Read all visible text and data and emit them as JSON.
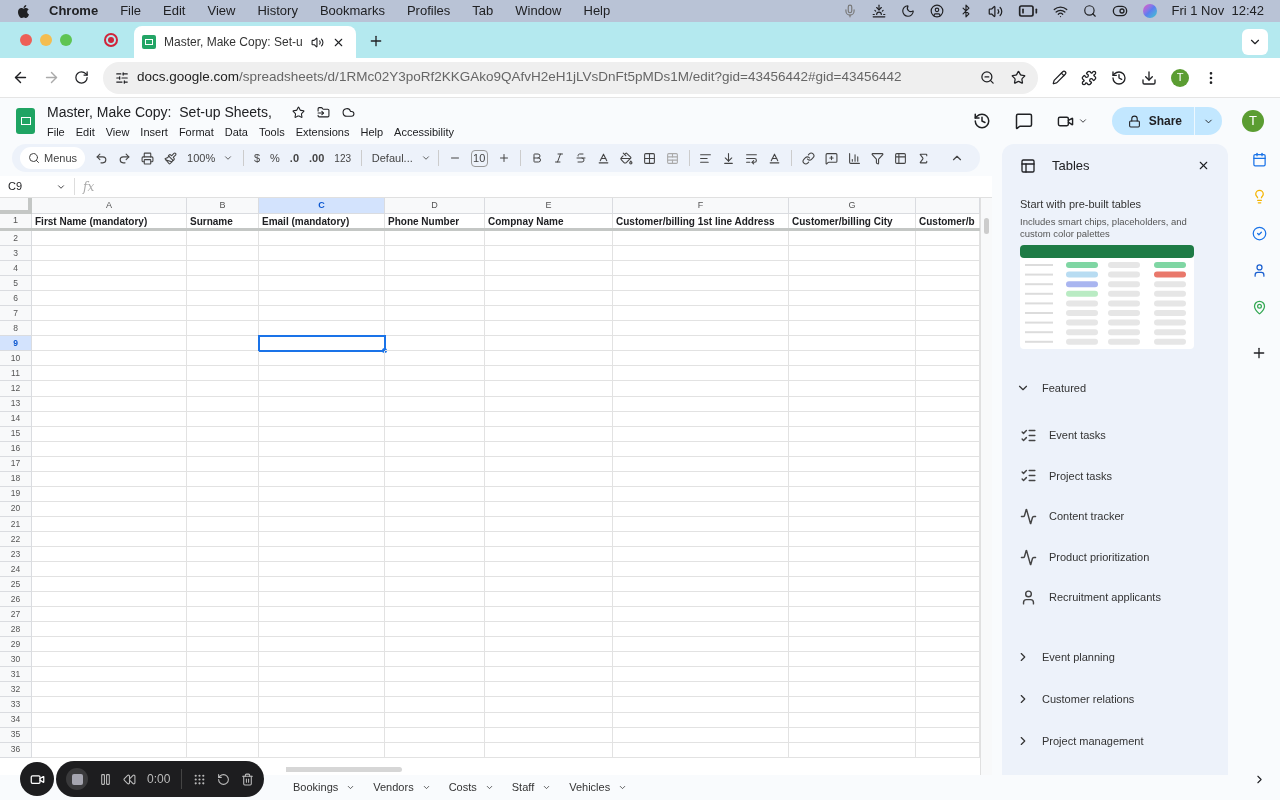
{
  "menubar": {
    "app": "Chrome",
    "items": [
      "File",
      "Edit",
      "View",
      "History",
      "Bookmarks",
      "Profiles",
      "Tab",
      "Window",
      "Help"
    ],
    "clock": "Fri 1 Nov  12:42"
  },
  "browser": {
    "tab_title": "Master, Make Copy: Set-u",
    "url_host": "docs.google.com",
    "url_path": "/spreadsheets/d/1RMc02Y3poRf2KKGAko9QAfvH2eH1jLVsDnFt5pMDs1M/edit?gid=43456442#gid=43456442",
    "avatar": "T"
  },
  "document": {
    "title": "Master, Make Copy:  Set-up Sheets,",
    "menus": [
      "File",
      "Edit",
      "View",
      "Insert",
      "Format",
      "Data",
      "Tools",
      "Extensions",
      "Help",
      "Accessibility"
    ],
    "share": "Share",
    "avatar": "T"
  },
  "toolbar": {
    "search": "Menus",
    "zoom": "100%",
    "currency": "$",
    "percent": "%",
    "decrease_decimal": ".0",
    "increase_decimal": ".00",
    "number_format": "123",
    "font": "Defaul...",
    "font_size": "10"
  },
  "name_box": "C9",
  "formula_label": "fx",
  "columns": [
    {
      "letter": "A",
      "header": "First Name (mandatory)",
      "selected": false
    },
    {
      "letter": "B",
      "header": "Surname",
      "selected": false
    },
    {
      "letter": "C",
      "header": "Email (mandatory)",
      "selected": true
    },
    {
      "letter": "D",
      "header": "Phone Number",
      "selected": false
    },
    {
      "letter": "E",
      "header": "Compnay Name",
      "selected": false
    },
    {
      "letter": "F",
      "header": "Customer/billing 1st line Address",
      "selected": false
    },
    {
      "letter": "G",
      "header": "Customer/billing City",
      "selected": false
    },
    {
      "header": "Customer/b",
      "selected": false
    }
  ],
  "header_row": "1",
  "rows": [
    {
      "number": "2",
      "selected": false
    },
    {
      "number": "3",
      "selected": false
    },
    {
      "number": "4",
      "selected": false
    },
    {
      "number": "5",
      "selected": false
    },
    {
      "number": "6",
      "selected": false
    },
    {
      "number": "7",
      "selected": false
    },
    {
      "number": "8",
      "selected": false
    },
    {
      "number": "9",
      "selected": true
    },
    {
      "number": "10",
      "selected": false
    },
    {
      "number": "11",
      "selected": false
    },
    {
      "number": "12",
      "selected": false
    },
    {
      "number": "13",
      "selected": false
    },
    {
      "number": "14",
      "selected": false
    },
    {
      "number": "15",
      "selected": false
    },
    {
      "number": "16",
      "selected": false
    },
    {
      "number": "17",
      "selected": false
    },
    {
      "number": "18",
      "selected": false
    },
    {
      "number": "19",
      "selected": false
    },
    {
      "number": "20",
      "selected": false
    },
    {
      "number": "21",
      "selected": false
    },
    {
      "number": "22",
      "selected": false
    },
    {
      "number": "23",
      "selected": false
    },
    {
      "number": "24",
      "selected": false
    },
    {
      "number": "25",
      "selected": false
    },
    {
      "number": "26",
      "selected": false
    },
    {
      "number": "27",
      "selected": false
    },
    {
      "number": "28",
      "selected": false
    },
    {
      "number": "29",
      "selected": false
    },
    {
      "number": "30",
      "selected": false
    },
    {
      "number": "31",
      "selected": false
    },
    {
      "number": "32",
      "selected": false
    },
    {
      "number": "33",
      "selected": false
    },
    {
      "number": "34",
      "selected": false
    },
    {
      "number": "35",
      "selected": false
    },
    {
      "number": "36",
      "selected": false
    }
  ],
  "side_panel": {
    "title": "Tables",
    "heading": "Start with pre-built tables",
    "description": "Includes smart chips, placeholders, and custom color palettes",
    "sections": [
      {
        "label": "Featured",
        "expanded": true,
        "items": [
          {
            "label": "Event tasks",
            "kind": "checklist"
          },
          {
            "label": "Project tasks",
            "kind": "checklist"
          },
          {
            "label": "Content tracker",
            "kind": "trend"
          },
          {
            "label": "Product prioritization",
            "kind": "trend"
          },
          {
            "label": "Recruitment applicants",
            "kind": "person"
          }
        ]
      },
      {
        "label": "Event planning",
        "expanded": false
      },
      {
        "label": "Customer relations",
        "expanded": false
      },
      {
        "label": "Project management",
        "expanded": false
      }
    ]
  },
  "sheet_tabs": [
    {
      "label": "Bookings",
      "selected": false
    },
    {
      "label": "Vendors",
      "selected": false
    },
    {
      "label": "Costs",
      "selected": false
    },
    {
      "label": "Staff",
      "selected": false
    },
    {
      "label": "Vehicles",
      "selected": false
    }
  ],
  "recorder": {
    "time": "0:00"
  }
}
